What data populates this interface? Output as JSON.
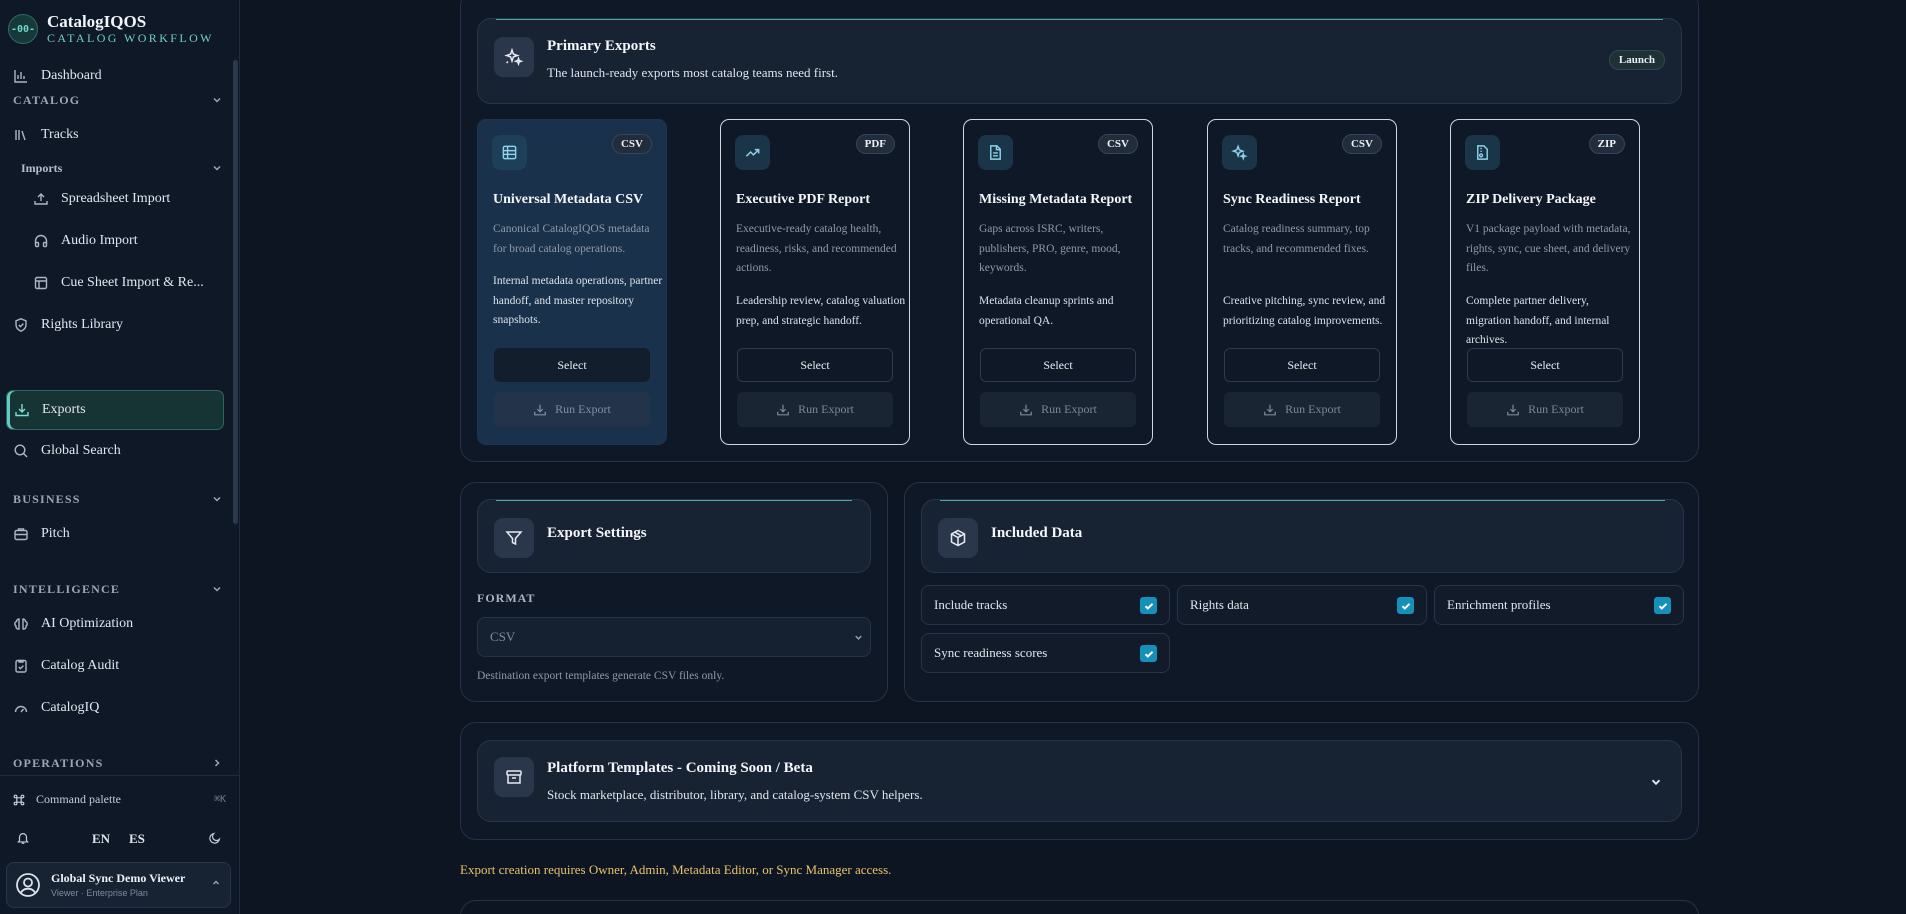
{
  "brand": {
    "logo_text": "-00-",
    "title": "CatalogIQOS",
    "subtitle": "CATALOG WORKFLOW"
  },
  "nav": {
    "dashboard": "Dashboard",
    "catalog_section": "CATALOG",
    "tracks": "Tracks",
    "imports_section": "Imports",
    "spreadsheet_import": "Spreadsheet Import",
    "audio_import": "Audio Import",
    "cue_sheet_import": "Cue Sheet Import & Re...",
    "rights_library": "Rights Library",
    "exports": "Exports",
    "global_search": "Global Search",
    "business_section": "BUSINESS",
    "pitch": "Pitch",
    "intelligence_section": "INTELLIGENCE",
    "ai_optimization": "AI Optimization",
    "catalog_audit": "Catalog Audit",
    "catalogiq": "CatalogIQ",
    "operations_section": "OPERATIONS"
  },
  "footer": {
    "command_palette": "Command palette",
    "shortcut": "⌘K",
    "lang_en": "EN",
    "lang_es": "ES",
    "user_name": "Global Sync Demo Viewer",
    "user_plan": "Viewer · Enterprise Plan"
  },
  "primary": {
    "title": "Primary Exports",
    "subtitle": "The launch-ready exports most catalog teams need first.",
    "badge": "Launch"
  },
  "cards": [
    {
      "format": "CSV",
      "title": "Universal Metadata CSV",
      "description": "Canonical CatalogIQOS metadata for broad catalog operations.",
      "use": "Internal metadata operations, partner handoff, and master repository snapshots.",
      "select": "Select",
      "run": "Run Export",
      "icon": "table-icon"
    },
    {
      "format": "PDF",
      "title": "Executive PDF Report",
      "description": "Executive-ready catalog health, readiness, risks, and recommended actions.",
      "use": "Leadership review, catalog valuation prep, and strategic handoff.",
      "select": "Select",
      "run": "Run Export",
      "icon": "trending-up-icon"
    },
    {
      "format": "CSV",
      "title": "Missing Metadata Report",
      "description": "Gaps across ISRC, writers, publishers, PRO, genre, mood, keywords.",
      "use": "Metadata cleanup sprints and operational QA.",
      "select": "Select",
      "run": "Run Export",
      "icon": "document-icon"
    },
    {
      "format": "CSV",
      "title": "Sync Readiness Report",
      "description": "Catalog readiness summary, top tracks, and recommended fixes.",
      "use": "Creative pitching, sync review, and prioritizing catalog improvements.",
      "select": "Select",
      "run": "Run Export",
      "icon": "sparkles-icon"
    },
    {
      "format": "ZIP",
      "title": "ZIP Delivery Package",
      "description": "V1 package payload with metadata, rights, sync, cue sheet, and delivery files.",
      "use": "Complete partner delivery, migration handoff, and internal archives.",
      "select": "Select",
      "run": "Run Export",
      "icon": "file-archive-icon"
    }
  ],
  "settings": {
    "title": "Export Settings",
    "format_label": "FORMAT",
    "format_value": "CSV",
    "hint": "Destination export templates generate CSV files only."
  },
  "included": {
    "title": "Included Data",
    "options": [
      {
        "label": "Include tracks",
        "checked": true
      },
      {
        "label": "Rights data",
        "checked": true
      },
      {
        "label": "Enrichment profiles",
        "checked": true
      },
      {
        "label": "Sync readiness scores",
        "checked": true
      }
    ]
  },
  "platform": {
    "title": "Platform Templates - Coming Soon / Beta",
    "subtitle": "Stock marketplace, distributor, library, and catalog-system CSV helpers."
  },
  "warning": "Export creation requires Owner, Admin, Metadata Editor, or Sync Manager access.",
  "colors": {
    "accent": "#62cdbf",
    "checkbox": "#1590b8",
    "warning": "#e8c26a",
    "selected_card": "#19314a"
  }
}
